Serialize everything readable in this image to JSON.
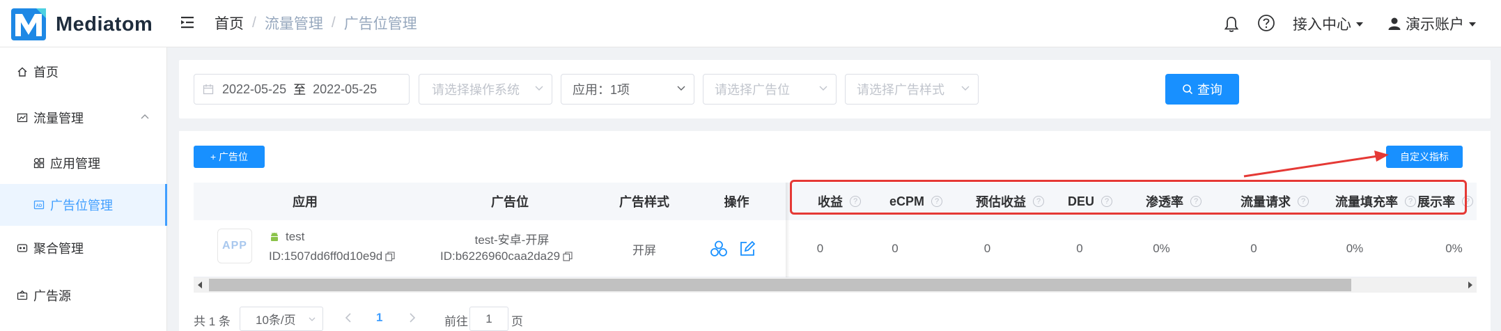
{
  "app": {
    "name": "Mediatom"
  },
  "colors": {
    "brand": "#1890ff",
    "active": "#409eff",
    "annotation": "#e53935",
    "android": "#8bc34a"
  },
  "header": {
    "breadcrumb": [
      "首页",
      "流量管理",
      "广告位管理"
    ],
    "access_center": "接入中心",
    "account": "演示账户"
  },
  "sidebar": {
    "items": [
      {
        "label": "首页",
        "icon": "home-icon"
      },
      {
        "label": "流量管理",
        "icon": "traffic-icon"
      },
      {
        "label": "应用管理",
        "icon": "apps-icon"
      },
      {
        "label": "广告位管理",
        "icon": "ad-slot-icon",
        "active": true
      },
      {
        "label": "聚合管理",
        "icon": "aggregate-icon"
      },
      {
        "label": "广告源",
        "icon": "ad-source-icon"
      }
    ]
  },
  "filters": {
    "date_start": "2022-05-25",
    "date_sep": "至",
    "date_end": "2022-05-25",
    "os_placeholder": "请选择操作系统",
    "app_value": "应用：1项",
    "adslot_placeholder": "请选择广告位",
    "style_placeholder": "请选择广告样式",
    "search_label": "查询"
  },
  "toolbar": {
    "add_label": "+ 广告位",
    "custom_metrics_label": "自定义指标"
  },
  "table": {
    "headers": {
      "app": "应用",
      "adslot": "广告位",
      "style": "广告样式",
      "ops": "操作",
      "metrics": [
        "收益",
        "eCPM",
        "预估收益",
        "DEU",
        "渗透率",
        "流量请求",
        "流量填充率",
        "展示率"
      ]
    },
    "rows": [
      {
        "app_logo_text": "APP",
        "app_name": "test",
        "app_id": "ID:1507dd6ff0d10e9d",
        "adslot_name": "test-安卓-开屏",
        "adslot_id": "ID:b6226960caa2da29",
        "style": "开屏",
        "metrics": [
          "0",
          "0",
          "0",
          "0",
          "0%",
          "0",
          "0%",
          "0%"
        ]
      }
    ]
  },
  "pagination": {
    "total": "共 1 条",
    "page_size": "10条/页",
    "current": "1",
    "goto_label": "前往",
    "goto_value": "1",
    "page_suffix": "页"
  }
}
